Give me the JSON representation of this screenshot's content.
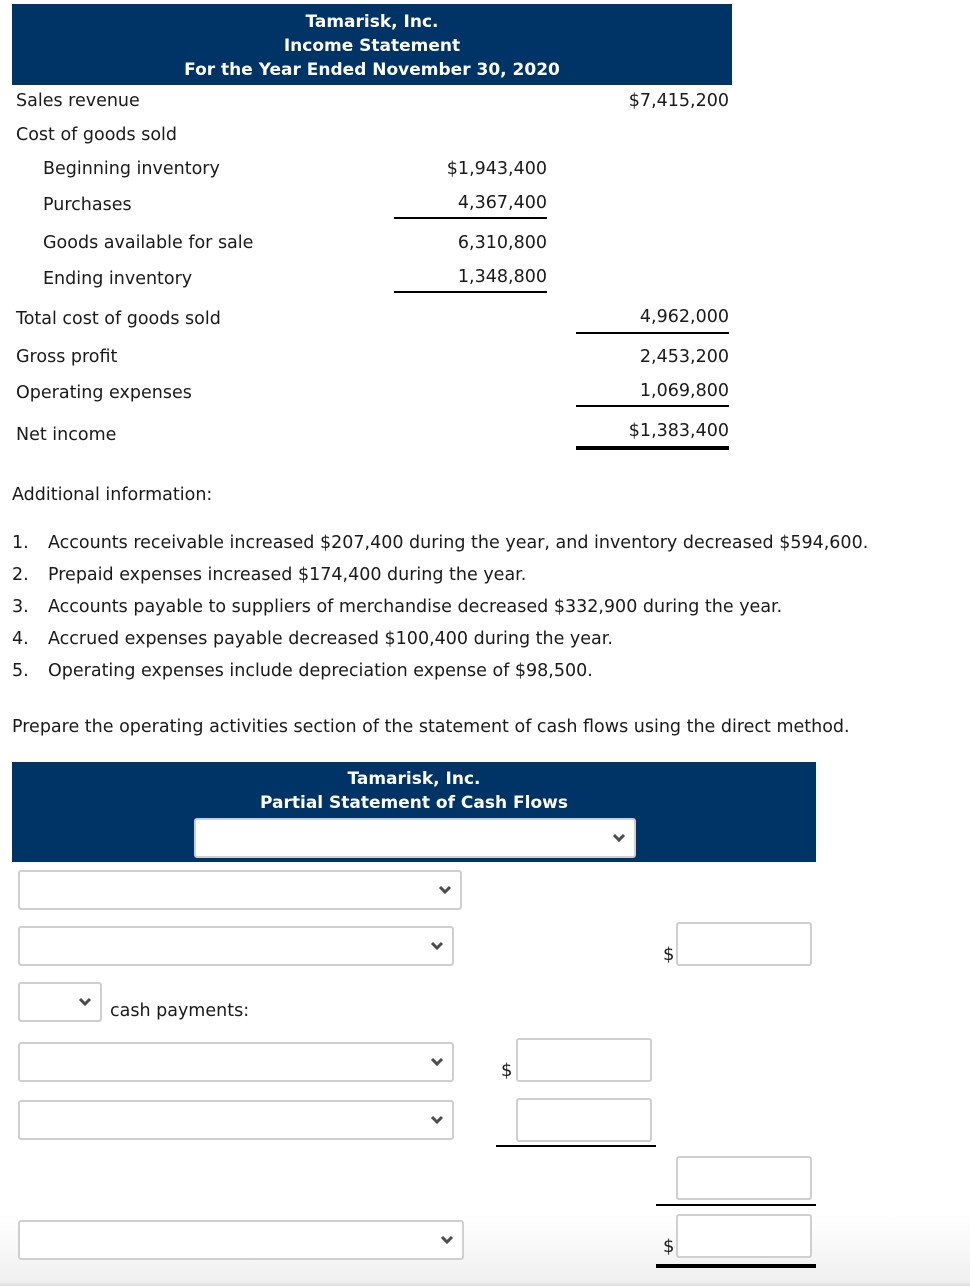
{
  "income_statement": {
    "header": {
      "company": "Tamarisk, Inc.",
      "title": "Income Statement",
      "period": "For the Year Ended November 30, 2020"
    },
    "rows": {
      "sales_revenue": {
        "label": "Sales revenue",
        "value": "$7,415,200"
      },
      "cogs_heading": {
        "label": "Cost of goods sold"
      },
      "beginning_inventory": {
        "label": "Beginning inventory",
        "value": "$1,943,400"
      },
      "purchases": {
        "label": "Purchases",
        "value": "4,367,400"
      },
      "goods_available": {
        "label": "Goods available for sale",
        "value": "6,310,800"
      },
      "ending_inventory": {
        "label": "Ending inventory",
        "value": "1,348,800"
      },
      "total_cogs": {
        "label": "Total cost of goods sold",
        "value": "4,962,000"
      },
      "gross_profit": {
        "label": "Gross profit",
        "value": "2,453,200"
      },
      "operating_expenses": {
        "label": "Operating expenses",
        "value": "1,069,800"
      },
      "net_income": {
        "label": "Net income",
        "value": "$1,383,400"
      }
    }
  },
  "additional_info": {
    "heading": "Additional information:",
    "items": [
      {
        "num": "1.",
        "text": "Accounts receivable increased $207,400 during the year, and inventory decreased $594,600."
      },
      {
        "num": "2.",
        "text": "Prepaid expenses increased $174,400 during the year."
      },
      {
        "num": "3.",
        "text": "Accounts payable to suppliers of merchandise decreased $332,900 during the year."
      },
      {
        "num": "4.",
        "text": "Accrued expenses payable decreased $100,400 during the year."
      },
      {
        "num": "5.",
        "text": "Operating expenses include depreciation expense of $98,500."
      }
    ]
  },
  "instruction": "Prepare the operating activities section of the statement of cash flows using the direct method.",
  "cash_flow_statement": {
    "header": {
      "company": "Tamarisk, Inc.",
      "title": "Partial Statement of Cash Flows",
      "period_select_value": ""
    },
    "rows": {
      "section_select_value": "",
      "receipts_select_value": "",
      "receipts_amount": "",
      "less_select_value": "",
      "cash_payments_label": "cash payments:",
      "payment1_select_value": "",
      "payment1_amount": "",
      "payment2_select_value": "",
      "payment2_amount": "",
      "total_payments_amount": "",
      "net_cash_select_value": "",
      "net_cash_amount": ""
    },
    "currency_symbol": "$"
  },
  "colors": {
    "header_bg": "#003366",
    "header_text": "#ffffff",
    "input_border": "#cfcfcf"
  }
}
